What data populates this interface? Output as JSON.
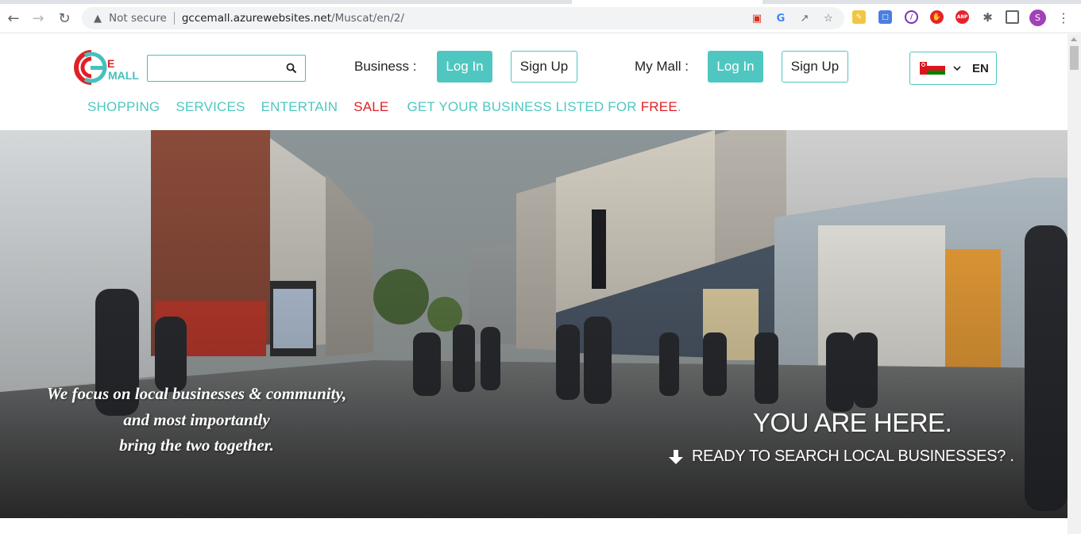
{
  "browser": {
    "url_secure_label": "Not secure",
    "url_domain": "gccemall.azurewebsites.net",
    "url_path": "/Muscat/en/2/",
    "profile_initial": "S"
  },
  "header": {
    "logo": {
      "letter_e": "E",
      "word_mall": "MALL",
      "brand_colors": {
        "red": "#e02026",
        "teal": "#45c1bb"
      }
    },
    "search": {
      "value": "",
      "placeholder": ""
    },
    "business": {
      "label": "Business :",
      "login": "Log In",
      "signup": "Sign Up"
    },
    "my_mall": {
      "label": "My Mall :",
      "login": "Log In",
      "signup": "Sign Up"
    },
    "language": {
      "code": "EN",
      "flag": "oman-flag"
    }
  },
  "nav": {
    "items": [
      {
        "label": "SHOPPING"
      },
      {
        "label": "SERVICES"
      },
      {
        "label": "ENTERTAIN"
      },
      {
        "label": "SALE"
      }
    ],
    "listing": {
      "prefix": "GET YOUR BUSINESS LISTED FOR ",
      "highlight": "FREE",
      "suffix": "."
    }
  },
  "hero": {
    "tagline": [
      "We focus on local businesses & community,",
      "and most importantly",
      "bring the two together."
    ],
    "title": "YOU ARE HERE.",
    "subtitle": "READY TO SEARCH LOCAL BUSINESSES? ."
  },
  "colors": {
    "accent": "#4fc7c0",
    "sale": "#e02026"
  }
}
